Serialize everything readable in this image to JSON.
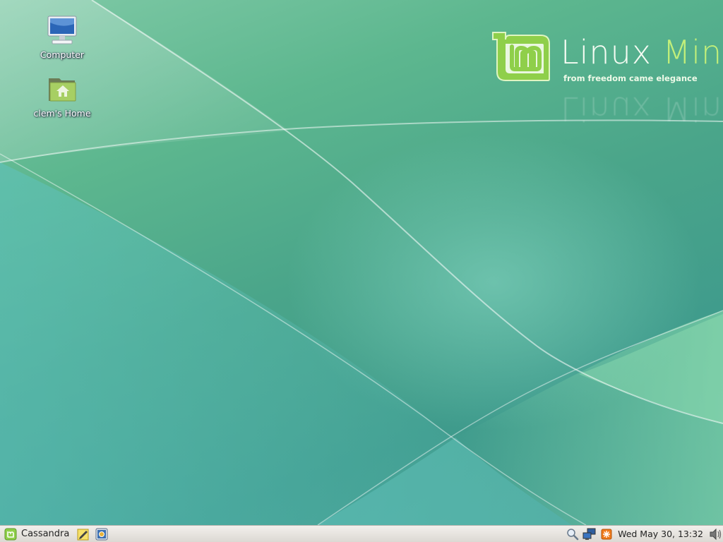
{
  "desktop": {
    "icons": [
      {
        "label": "Computer",
        "icon": "computer-icon"
      },
      {
        "label": "clem's Home",
        "icon": "home-folder-icon"
      }
    ]
  },
  "wallpaper": {
    "brand_1": "Linux",
    "brand_2": "Mint",
    "tagline": "from freedom came elegance",
    "colors": {
      "accent": "#8fcf4a",
      "wordmark": "#f4fbf2",
      "mint": "#c2ef7a"
    }
  },
  "panel": {
    "menu_label": "Cassandra",
    "launchers": [
      "text-editor-icon",
      "screenshot-icon"
    ],
    "tray": [
      "search-icon",
      "network-icon",
      "update-manager-icon",
      "volume-icon"
    ],
    "clock": "Wed May 30, 13:32"
  }
}
